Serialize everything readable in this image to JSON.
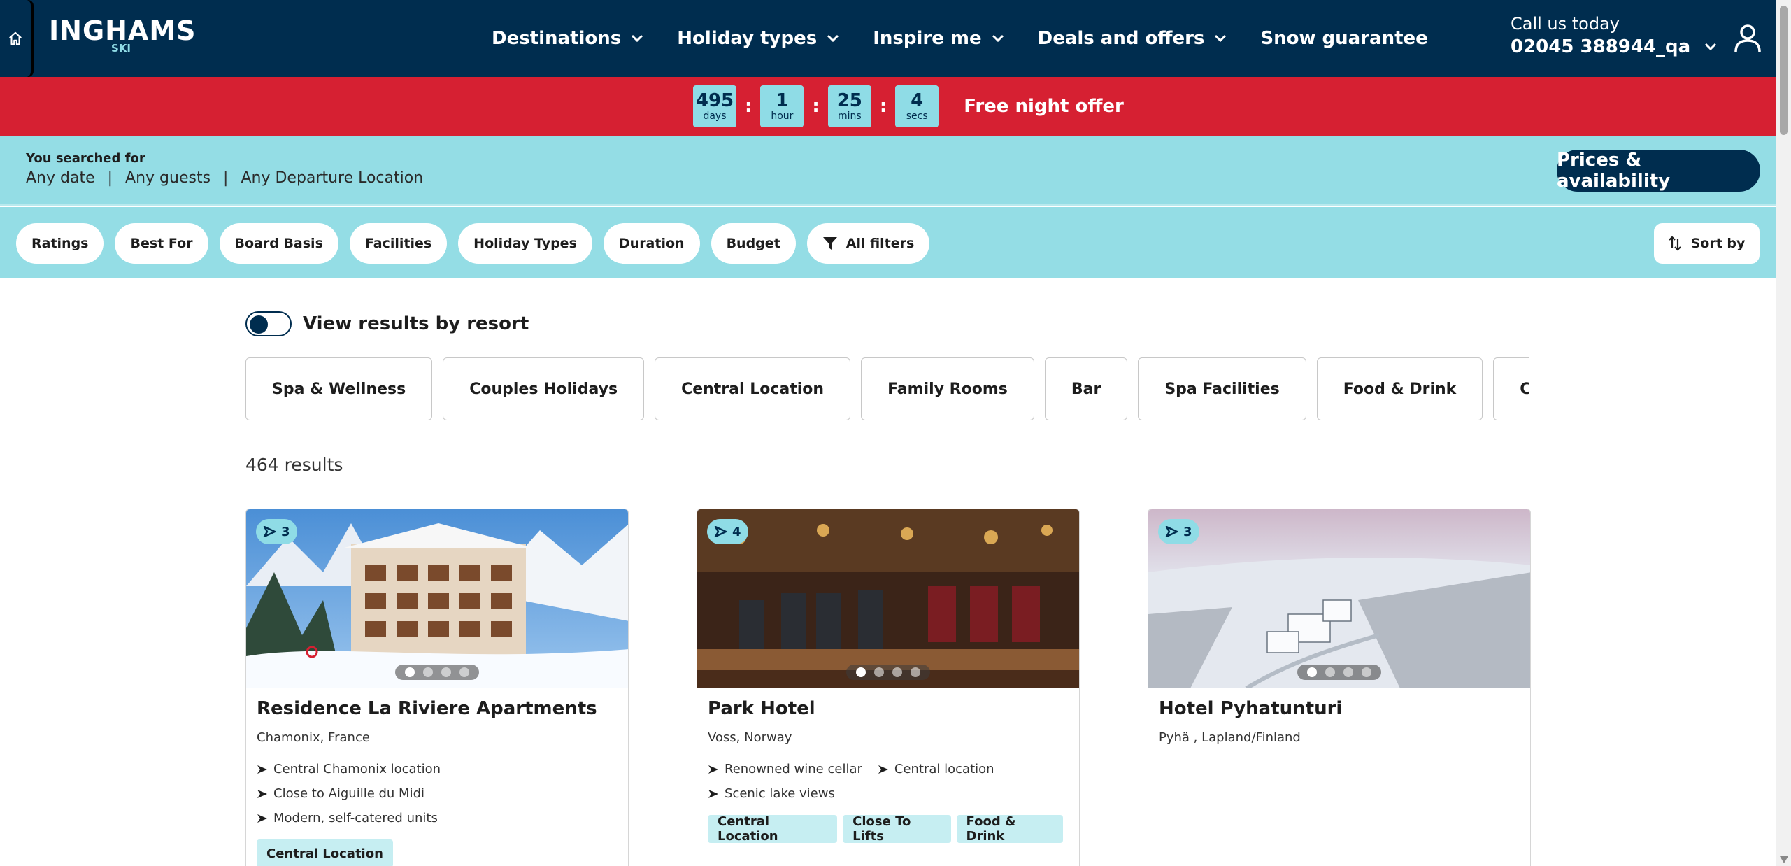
{
  "header": {
    "logo_main": "INGHAMS",
    "logo_sub": "SKI",
    "nav": [
      {
        "label": "Destinations"
      },
      {
        "label": "Holiday types"
      },
      {
        "label": "Inspire me"
      },
      {
        "label": "Deals and offers"
      },
      {
        "label": "Snow guarantee"
      }
    ],
    "call_label": "Call us today",
    "call_number": "02045 388944_qa"
  },
  "offer": {
    "days": "495",
    "days_label": "days",
    "hours": "1",
    "hours_label": "hour",
    "mins": "25",
    "mins_label": "mins",
    "secs": "4",
    "secs_label": "secs",
    "separator": ":",
    "text": "Free night offer"
  },
  "summary": {
    "label": "You searched for",
    "date": "Any date",
    "guests": "Any guests",
    "departure": "Any Departure Location",
    "separator": "|",
    "prices_button": "Prices & availability"
  },
  "filters": {
    "pills": [
      "Ratings",
      "Best For",
      "Board Basis",
      "Facilities",
      "Holiday Types",
      "Duration",
      "Budget"
    ],
    "all_filters": "All filters",
    "sort_by": "Sort by"
  },
  "main": {
    "toggle_label": "View results by resort",
    "toggle_on": false,
    "chips": [
      "Spa & Wellness",
      "Couples Holidays",
      "Central Location",
      "Family Rooms",
      "Bar",
      "Spa Facilities",
      "Food & Drink",
      "Close to Lifts"
    ],
    "results_count": "464 results"
  },
  "cards": [
    {
      "badge": "3",
      "title": "Residence La Riviere Apartments",
      "location": "Chamonix, France",
      "features": [
        "Central Chamonix location",
        "Close to Aiguille du Midi",
        "Modern, self-catered units"
      ],
      "tags": [
        "Central Location"
      ]
    },
    {
      "badge": "4",
      "title": "Park Hotel",
      "location": "Voss, Norway",
      "features": [
        "Renowned wine cellar",
        "Central location",
        "Scenic lake views"
      ],
      "tags": [
        "Central Location",
        "Close To Lifts",
        "Food & Drink"
      ]
    },
    {
      "badge": "3",
      "title": "Hotel Pyhatunturi",
      "location": "Pyhä , Lapland/Finland",
      "features": [],
      "tags": []
    }
  ],
  "colors": {
    "navy": "#002d4f",
    "red": "#d62032",
    "aqua": "#94dde5",
    "aqua_light": "#c6eef2"
  }
}
